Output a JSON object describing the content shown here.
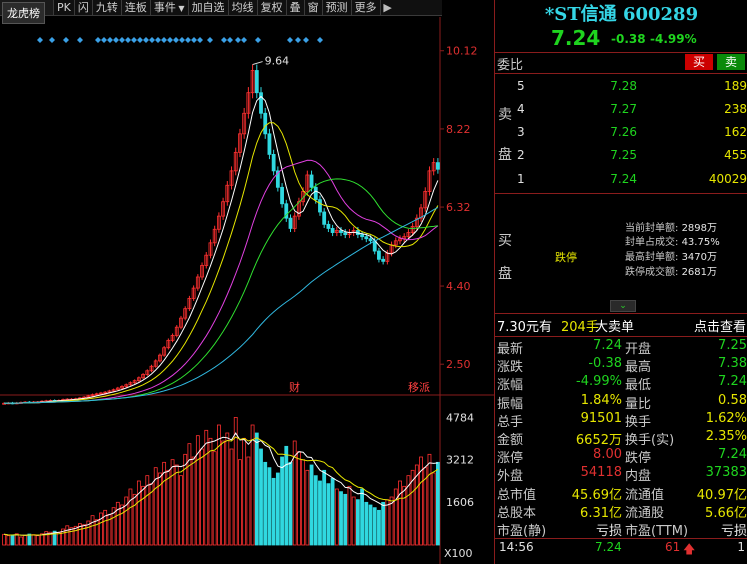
{
  "toolbar": {
    "tag": "龙虎榜",
    "items": [
      "PK",
      "闪",
      "九转",
      "连板",
      "事件",
      "加自选",
      "均线",
      "复权",
      "叠",
      "窗",
      "预测",
      "更多"
    ],
    "icons": [
      "gear-icon",
      "pen-icon",
      "eye-icon",
      "grid-icon",
      "plus-circle-icon",
      "minus-circle-icon"
    ]
  },
  "chart": {
    "price_axis": [
      "10.12",
      "8.22",
      "6.32",
      "4.40",
      "2.50"
    ],
    "volume_axis": [
      "4784",
      "3212",
      "1606"
    ],
    "volume_unit": "X100",
    "peak_label": "9.64",
    "event_labels": [
      "财",
      "移派"
    ]
  },
  "chart_data": {
    "type": "line",
    "price_axis_ticks": [
      10.12,
      8.22,
      6.32,
      4.4,
      2.5
    ],
    "volume_axis_ticks": [
      4784,
      3212,
      1606
    ],
    "ylim": [
      1.8,
      10.6
    ],
    "volume_ylim": [
      0,
      5400
    ],
    "candles": [
      1.55,
      1.56,
      1.55,
      1.56,
      1.57,
      1.58,
      1.57,
      1.58,
      1.58,
      1.6,
      1.61,
      1.62,
      1.61,
      1.62,
      1.64,
      1.65,
      1.65,
      1.66,
      1.68,
      1.7,
      1.73,
      1.76,
      1.78,
      1.8,
      1.82,
      1.85,
      1.88,
      1.92,
      1.96,
      2.0,
      2.05,
      2.1,
      2.17,
      2.25,
      2.34,
      2.45,
      2.58,
      2.72,
      2.9,
      3.08,
      3.2,
      3.4,
      3.62,
      3.85,
      4.1,
      4.35,
      4.62,
      4.9,
      5.15,
      5.45,
      5.78,
      6.1,
      6.45,
      6.85,
      7.2,
      7.65,
      8.1,
      8.6,
      9.1,
      9.64,
      9.1,
      8.6,
      8.1,
      7.6,
      7.2,
      6.8,
      6.4,
      6.05,
      5.8,
      6.1,
      6.45,
      6.7,
      7.1,
      6.8,
      6.5,
      6.2,
      5.9,
      5.8,
      5.7,
      5.75,
      5.7,
      5.65,
      5.7,
      5.75,
      5.65,
      5.6,
      5.55,
      5.5,
      5.25,
      5.05,
      5.0,
      5.2,
      5.4,
      5.5,
      5.55,
      5.6,
      5.7,
      5.85,
      6.05,
      6.3,
      6.7,
      7.2,
      7.4,
      7.24
    ],
    "volume": [
      400,
      350,
      380,
      420,
      300,
      360,
      410,
      390,
      350,
      420,
      500,
      480,
      520,
      460,
      600,
      720,
      650,
      700,
      800,
      760,
      900,
      1100,
      950,
      1200,
      1300,
      1150,
      1400,
      1600,
      1500,
      1800,
      2100,
      1900,
      2400,
      2200,
      2600,
      2300,
      2900,
      2700,
      3100,
      2800,
      3200,
      3000,
      2600,
      3400,
      3800,
      3300,
      4100,
      3600,
      4300,
      4000,
      3500,
      4500,
      3900,
      4200,
      3600,
      4784,
      3200,
      4000,
      3300,
      4500,
      4200,
      3600,
      3100,
      2900,
      2500,
      2700,
      3300,
      3700,
      3100,
      3900,
      3500,
      3200,
      2800,
      3000,
      2600,
      2400,
      2800,
      2300,
      2500,
      2100,
      2000,
      1900,
      2200,
      1800,
      1700,
      2100,
      1600,
      1500,
      1400,
      1300,
      1600,
      1700,
      1800,
      2100,
      2400,
      2200,
      2600,
      2800,
      3000,
      3300,
      2900,
      3400,
      2700,
      3100
    ]
  },
  "panel": {
    "title": "*ST信通 600289",
    "price": "7.24",
    "change": "-0.38",
    "pct": "-4.99%",
    "weibi_label": "委比",
    "buy_label": "买",
    "sell_label": "卖",
    "sell_side_label": [
      "卖",
      "盘"
    ],
    "buy_side_label": [
      "买",
      "盘"
    ],
    "order_book": [
      {
        "level": "5",
        "price": "7.28",
        "volume": "189"
      },
      {
        "level": "4",
        "price": "7.27",
        "volume": "238"
      },
      {
        "level": "3",
        "price": "7.26",
        "volume": "162"
      },
      {
        "level": "2",
        "price": "7.25",
        "volume": "455"
      },
      {
        "level": "1",
        "price": "7.24",
        "volume": "40029"
      }
    ],
    "limit_down_text": "跌停",
    "seal_info": [
      {
        "label": "当前封单额:",
        "value": "2898万"
      },
      {
        "label": "封单占成交:",
        "value": "43.75%"
      },
      {
        "label": "最高封单额:",
        "value": "3470万"
      },
      {
        "label": "跌停成交额:",
        "value": "2681万"
      }
    ],
    "ad": {
      "price_label": "7.30元有",
      "vol": "204手",
      "label": "大卖单",
      "link": "点击查看"
    },
    "quotes": [
      {
        "l": "最新",
        "lv": "7.24",
        "lc": "green",
        "r": "开盘",
        "rv": "7.25",
        "rc": "green"
      },
      {
        "l": "涨跌",
        "lv": "-0.38",
        "lc": "green",
        "r": "最高",
        "rv": "7.38",
        "rc": "green"
      },
      {
        "l": "涨幅",
        "lv": "-4.99%",
        "lc": "green",
        "r": "最低",
        "rv": "7.24",
        "rc": "green"
      },
      {
        "l": "振幅",
        "lv": "1.84%",
        "lc": "yellow",
        "r": "量比",
        "rv": "0.58",
        "rc": "yellow"
      },
      {
        "l": "总手",
        "lv": "91501",
        "lc": "yellow",
        "r": "换手",
        "rv": "1.62%",
        "rc": "yellow"
      },
      {
        "l": "金额",
        "lv": "6652万",
        "lc": "yellow",
        "r": "换手(实)",
        "rv": "2.35%",
        "rc": "yellow"
      },
      {
        "l": "涨停",
        "lv": "8.00",
        "lc": "red",
        "r": "跌停",
        "rv": "7.24",
        "rc": "green"
      },
      {
        "l": "外盘",
        "lv": "54118",
        "lc": "red",
        "r": "内盘",
        "rv": "37383",
        "rc": "green"
      },
      {
        "l": "总市值",
        "lv": "45.69亿",
        "lc": "yellow",
        "r": "流通值",
        "rv": "40.97亿",
        "rc": "yellow"
      },
      {
        "l": "总股本",
        "lv": "6.31亿",
        "lc": "yellow",
        "r": "流通股",
        "rv": "5.66亿",
        "rc": "yellow"
      },
      {
        "l": "市盈(静)",
        "lv": "亏损",
        "lc": "white",
        "r": "市盈(TTM)",
        "rv": "亏损",
        "rc": "white"
      }
    ],
    "tick": {
      "time": "14:56",
      "price": "7.24",
      "vol": "61",
      "dir_icon": "up-arrow-icon",
      "num": "1"
    }
  }
}
